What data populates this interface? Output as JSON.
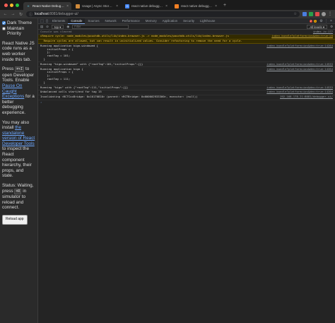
{
  "browser": {
    "tabs": [
      {
        "title": "React Native Debugger",
        "active": true,
        "fav_color": "#e8e8e8"
      },
      {
        "title": "Usage | Async Storage",
        "active": false,
        "fav_color": "#d08a3a"
      },
      {
        "title": "react native debugger is not w...",
        "active": false,
        "fav_color": "#4285f4"
      },
      {
        "title": "react native debugger freezin...",
        "active": false,
        "fav_color": "#f48024"
      }
    ],
    "new_tab": "+",
    "url_host": "localhost",
    "url_path": ":8081/debugger-ui/",
    "colors": {
      "close": "#ff5f57",
      "minimize": "#febc2e",
      "maximize": "#28c840"
    }
  },
  "page": {
    "dark_theme_label": "Dark Theme",
    "maintain_priority_label": "Maintain Priority",
    "intro": "React Native JS code runs as a web worker inside this tab.",
    "press_prefix": "Press",
    "press_key": "⌘⌥I",
    "press_suffix": "to open Developer Tools. Enable",
    "pause_link": "Pause On Caught Exceptions",
    "press_tail": "for a better debugging experience.",
    "install_prefix": "You may also install",
    "standalone_link": "the standalone version of React Developer Tools",
    "install_suffix": "to inspect the React component hierarchy, their props, and state.",
    "status": "Status: Waiting, press",
    "status_key": "⌘R",
    "status_tail": "in simulator to reload and connect.",
    "reload_button": "Reload app"
  },
  "devtools": {
    "tabs": [
      "Elements",
      "Console",
      "Sources",
      "Network",
      "Performance",
      "Memory",
      "Application",
      "Security",
      "Lighthouse"
    ],
    "active_tab": "Console",
    "error_count": "2",
    "warn_count": "1",
    "context": "top",
    "filter_placeholder": "Filter",
    "levels": "All levels ▾",
    "rows": [
      {
        "kind": "info",
        "msg": "Console was cleared",
        "src": "index.js:177"
      },
      {
        "kind": "warn",
        "msg": "▸Require cycle: node_modules/pouchdb-utils/lib/index-browser.js -> node_modules/pouchdb-utils/lib/index-browser.js",
        "src": "index.bundle?platform=ios&dev=true:28"
      },
      {
        "kind": "warn",
        "msg": "  Require cycles are allowed, but can result in uninitialized values. Consider refactoring to remove the need for a cycle.",
        "src": ""
      },
      {
        "kind": "log",
        "msg": "Running application kigo-windowed {\n    initialProps = {\n    };\n    rootTag = 101;\n  }",
        "src": "index.bundle?platform=ios&dev=true:14284"
      },
      {
        "kind": "log",
        "msg": "Running \"kigo-windowed\" with {\"rootTag\":101,\"initialProps\":{}}",
        "src": "index.bundle?platform=ios&dev=true:14533"
      },
      {
        "kind": "log",
        "msg": "Running application kigo {\n    initialProps = {\n    };\n    rootTag = 111;\n  }",
        "src": "index.bundle?platform=ios&dev=true:14284"
      },
      {
        "kind": "log",
        "msg": "Running \"kigo\" with {\"rootTag\":111,\"initialProps\":{}}",
        "src": "index.bundle?platform=ios&dev=true:14533"
      },
      {
        "kind": "log",
        "msg": "Unbalanced calls start/end for tag 15",
        "src": "index.bundle?platform=ios&dev=true:14284"
      },
      {
        "kind": "log",
        "msg": "Invalidating <RCTCxxBridge: 0x10170810> (parent: <RCTBridge: 0x600002933300>, executor: (null))",
        "src": "192.168.178.21:8081/debugger-ui/"
      }
    ],
    "prompt": "›"
  }
}
